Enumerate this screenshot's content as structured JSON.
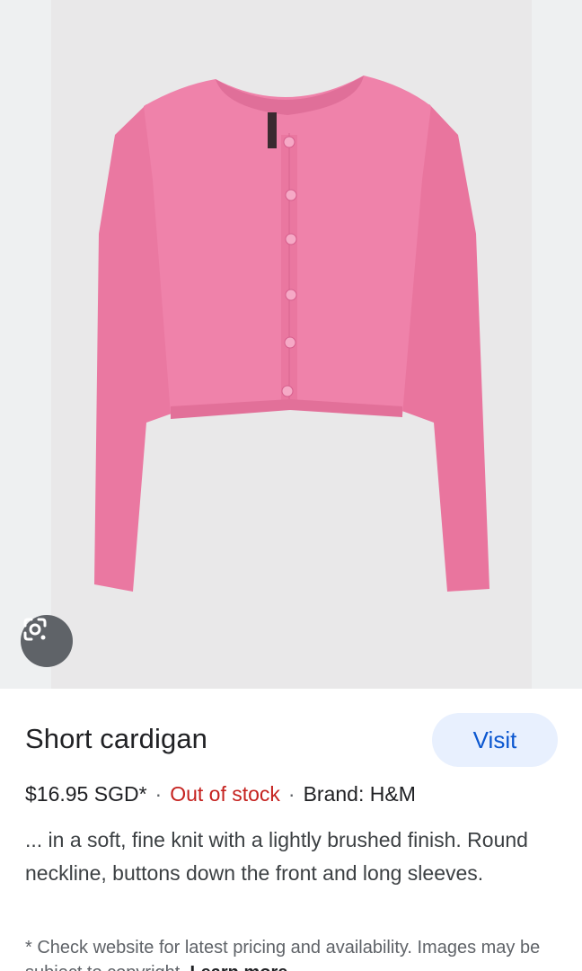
{
  "product": {
    "image_subject": "Pink short cardigan",
    "title": "Short cardigan",
    "visit_label": "Visit",
    "price": "$16.95 SGD*",
    "separator": "·",
    "stock_status": "Out of stock",
    "brand": "Brand: H&M",
    "description": "... in a soft, fine knit with a lightly brushed finish. Round neckline, buttons down the front and long sleeves.",
    "footnote": "* Check website for latest pricing and availability. Images may be subject to copyright.",
    "learn_more_label": "Learn more"
  },
  "icons": {
    "lens": "google-lens-icon"
  },
  "colors": {
    "accent_blue": "#0b57d0",
    "visit_bg": "#e8f0fe",
    "out_of_stock": "#c5221f",
    "cardigan_pink": "#ec7aa3"
  }
}
